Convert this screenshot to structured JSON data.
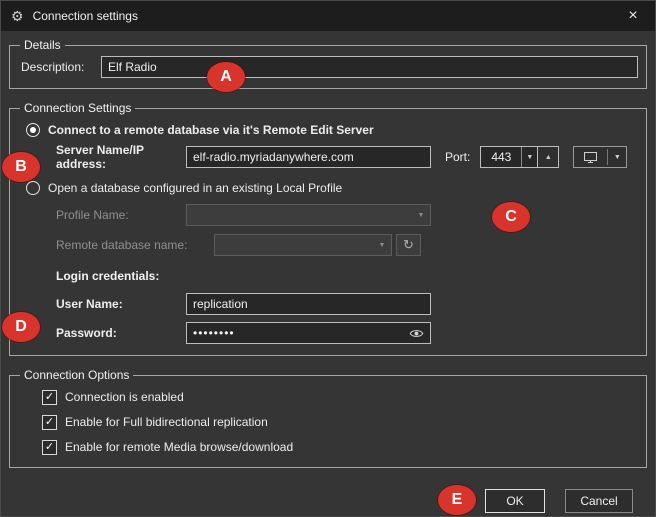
{
  "window": {
    "title": "Connection settings"
  },
  "icons": {
    "gear": "⚙",
    "close": "×",
    "dropdown": "▼",
    "up": "▲",
    "refresh": "↻",
    "check": "✓"
  },
  "details": {
    "legend": "Details",
    "description_label": "Description:",
    "description_value": "Elf Radio"
  },
  "connection": {
    "legend": "Connection Settings",
    "remote_radio_label": "Connect to a remote database via it's Remote Edit Server",
    "remote_radio_selected": true,
    "server_label": "Server Name/IP address:",
    "server_value": "elf-radio.myriadanywhere.com",
    "port_label": "Port:",
    "port_value": "443",
    "local_radio_label": "Open a database configured in an existing Local Profile",
    "local_radio_selected": false,
    "profile_label": "Profile Name:",
    "profile_value": "",
    "remote_db_label": "Remote database name:",
    "remote_db_value": "",
    "credentials_label": "Login credentials:",
    "username_label": "User Name:",
    "username_value": "replication",
    "password_label": "Password:",
    "password_value": "••••••••"
  },
  "options": {
    "legend": "Connection Options",
    "checkboxes": [
      {
        "label": "Connection is enabled",
        "checked": true,
        "glyph": "✓"
      },
      {
        "label": "Enable for Full bidirectional replication",
        "checked": true,
        "glyph": "✓"
      },
      {
        "label": "Enable for remote Media browse/download",
        "checked": true,
        "glyph": "✓"
      }
    ]
  },
  "footer": {
    "ok_label": "OK",
    "cancel_label": "Cancel"
  },
  "annotations": {
    "color": "#d9342c",
    "badges": [
      {
        "label": "A"
      },
      {
        "label": "B"
      },
      {
        "label": "C"
      },
      {
        "label": "D"
      },
      {
        "label": "E"
      }
    ]
  }
}
